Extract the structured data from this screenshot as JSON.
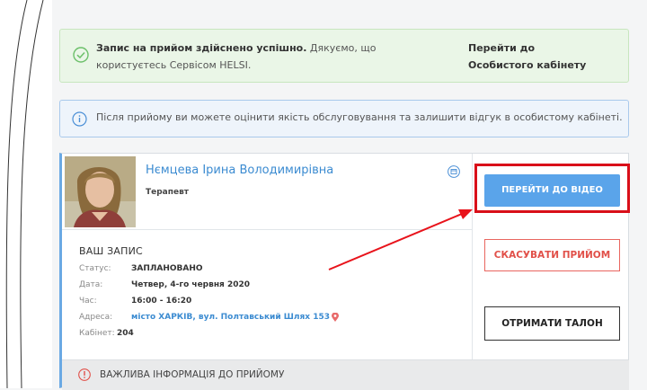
{
  "success_alert": {
    "bold_text": "Запис на прийом здійснено успішно.",
    "text": " Дякуємо, що користуєтесь Сервісом HELSI.",
    "cabinet_link": "Перейти до Особистого кабінету"
  },
  "info_alert": {
    "text": "Після прийому ви можете оцінити якість обслуговування та залишити відгук в особистому кабінеті."
  },
  "doctor": {
    "name": "Нємцева Ірина Володимирівна",
    "role": "Терапевт"
  },
  "appointment": {
    "title": "ВАШ ЗАПИС",
    "status_label": "Статус:",
    "status_value": "ЗАПЛАНОВАНО",
    "date_label": "Дата:",
    "date_value": "Четвер, 4-го червня 2020",
    "time_label": "Час:",
    "time_value": "16:00 - 16:20",
    "address_label": "Адреса:",
    "address_value": "місто ХАРКІВ, вул. Полтавський Шлях 153",
    "cabinet_label": "Кабінет:",
    "cabinet_value": "204"
  },
  "buttons": {
    "video": "ПЕРЕЙТИ ДО ВІДЕО",
    "cancel": "СКАСУВАТИ ПРИЙОМ",
    "ticket": "ОТРИМАТИ ТАЛОН"
  },
  "important": {
    "text": "ВАЖЛИВА ІНФОРМАЦІЯ ДО ПРИЙОМУ"
  },
  "colors": {
    "accent_blue": "#5aa4ea",
    "link_blue": "#3b8bd1",
    "highlight_red": "#d90f19",
    "cancel_red": "#e15049",
    "success_bg": "#eaf6e7"
  },
  "icons": [
    "check-circle-icon",
    "info-circle-icon",
    "calendar-icon",
    "map-pin-icon",
    "warning-circle-icon",
    "arrow-annotation"
  ]
}
